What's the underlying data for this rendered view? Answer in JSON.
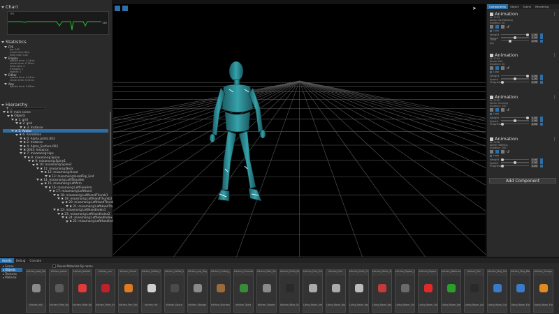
{
  "chart_panel": {
    "title": "Chart",
    "fps_label": "FPS",
    "fps_value": "165"
  },
  "statistics": {
    "title": "Statistics",
    "sections": [
      {
        "name": "FPS",
        "lines": [
          "fps: 165",
          "frame time: 6ms",
          "fixed rate: 0.02"
        ]
      },
      {
        "name": "Engine",
        "lines": [
          "update time: 0.14ms",
          "render time: 0.76ms",
          "draw calls: 4",
          "triangles: 1",
          "objects: 1"
        ]
      },
      {
        "name": "Editor",
        "lines": [
          "update time: 0.04ms",
          "render time: 0.01ms"
        ]
      },
      {
        "name": "App",
        "lines": [
          "update time: 0.08ms"
        ]
      }
    ]
  },
  "hierarchy": {
    "title": "Hierarchy",
    "items": [
      {
        "label": "0: main scene",
        "depth": 0,
        "selected": false
      },
      {
        "label": "Objects",
        "depth": 1,
        "selected": false
      },
      {
        "label": "1: grid",
        "depth": 2,
        "selected": false
      },
      {
        "label": "2: grid",
        "depth": 3,
        "selected": false
      },
      {
        "label": "3: Instance",
        "depth": 4,
        "selected": false
      },
      {
        "label": "5: Avatar",
        "depth": 2,
        "selected": true
      },
      {
        "label": "6: Animation",
        "depth": 3,
        "selected": false
      },
      {
        "label": "0: Alpha_Joints.003",
        "depth": 4,
        "selected": false
      },
      {
        "label": "2: Instance",
        "depth": 4,
        "selected": false
      },
      {
        "label": "4: Alpha_Surface.003",
        "depth": 4,
        "selected": false
      },
      {
        "label": "0003: Instance",
        "depth": 4,
        "selected": false
      },
      {
        "label": "7: mixamorig:Hips",
        "depth": 4,
        "selected": false
      },
      {
        "label": "8: mixamorig:Spine",
        "depth": 5,
        "selected": false
      },
      {
        "label": "9: mixamorig:Spine1",
        "depth": 6,
        "selected": false
      },
      {
        "label": "10: mixamorig:Spine2",
        "depth": 7,
        "selected": false
      },
      {
        "label": "11: mixamorig:Neck",
        "depth": 8,
        "selected": false
      },
      {
        "label": "12: mixamorig:Head",
        "depth": 9,
        "selected": false
      },
      {
        "label": "13: mixamorig:HeadTop_End",
        "depth": 10,
        "selected": false
      },
      {
        "label": "14: mixamorig:LeftShoulder",
        "depth": 8,
        "selected": false
      },
      {
        "label": "15: mixamorig:LeftArm",
        "depth": 9,
        "selected": false
      },
      {
        "label": "16: mixamorig:LeftForeArm",
        "depth": 10,
        "selected": false
      },
      {
        "label": "17: mixamorig:LeftHand",
        "depth": 11,
        "selected": false
      },
      {
        "label": "18: mixamorig:LeftHandThumb1",
        "depth": 12,
        "selected": false
      },
      {
        "label": "19: mixamorig:LeftHandThumb2",
        "depth": 13,
        "selected": false
      },
      {
        "label": "20: mixamorig:LeftHandThumb3",
        "depth": 14,
        "selected": false
      },
      {
        "label": "21: mixamorig:LeftHandThumb4",
        "depth": 15,
        "selected": false
      },
      {
        "label": "22: mixamorig:LeftHandIndex1",
        "depth": 12,
        "selected": false
      },
      {
        "label": "23: mixamorig:LeftHandIndex2",
        "depth": 13,
        "selected": false
      },
      {
        "label": "24: mixamorig:LeftHandIndex3",
        "depth": 14,
        "selected": false
      },
      {
        "label": "25: mixamorig:LeftHandIndex4",
        "depth": 15,
        "selected": false
      }
    ]
  },
  "inspector": {
    "tabs": [
      "Components",
      "Object",
      "Scene",
      "Rendering"
    ],
    "components": [
      {
        "title": "Animation",
        "id": "Id: 1743",
        "lines": [
          "Name: Idle/Walking",
          "Duration: 20"
        ],
        "loop_label": "Loop",
        "sliders": [
          {
            "label": "Weight",
            "value": "1.00",
            "pos": 1.0
          },
          {
            "label": "Speed",
            "value": "1.00",
            "pos": 0.5
          },
          {
            "label": "Time fps",
            "value": "0.90",
            "pos": 0.3
          }
        ]
      },
      {
        "title": "Animation",
        "id": "Id: 1744",
        "lines": [
          "Name: Idle",
          "Duration: 20"
        ],
        "loop_label": "Loop",
        "sliders": [
          {
            "label": "Weight",
            "value": "1.00",
            "pos": 1.0
          },
          {
            "label": "Speed",
            "value": "1.00",
            "pos": 0.5
          },
          {
            "label": "Progress",
            "value": "0.00",
            "pos": 0.0
          }
        ]
      },
      {
        "title": "Animation",
        "id": "Id: 1745",
        "lines": [
          "Name: Running",
          "Duration: 150"
        ],
        "loop_label": "Loop",
        "sliders": [
          {
            "label": "Weight",
            "value": "1.00",
            "pos": 1.0
          },
          {
            "label": "Speed",
            "value": "1.00",
            "pos": 0.5
          },
          {
            "label": "Progress",
            "value": "0.00",
            "pos": 0.0
          }
        ]
      },
      {
        "title": "Animation",
        "id": "Id: 1746",
        "lines": [
          "Name: Walking",
          "Duration: 100"
        ],
        "loop_label": "Loop",
        "sliders": [
          {
            "label": "Weight",
            "value": "0.00",
            "pos": 0.0
          },
          {
            "label": "Speed",
            "value": "1.00",
            "pos": 0.5
          },
          {
            "label": "Progress",
            "value": "0.00",
            "pos": 0.0
          }
        ]
      }
    ],
    "add_component": "Add Component"
  },
  "bottom": {
    "tabs": [
      "Assets",
      "Debug",
      "Console"
    ],
    "folders": [
      "Scene",
      "Objects",
      "Textures",
      "Material"
    ],
    "checkbox_label": "Reuse Materials By name",
    "assets": [
      {
        "top": "kitchen_bowl_NoMt",
        "bottom": "kitchen_Mix",
        "color": "#8a8a8a"
      },
      {
        "top": "kitchen_bottle",
        "bottom": "kitchen_Plate_Bowl_Mat",
        "color": "#5a5a5a"
      },
      {
        "top": "kitchen_bottle2",
        "bottom": "kitchen_Plate_Bowl_Knife",
        "color": "#e03a3a"
      },
      {
        "top": "kitchen_can",
        "bottom": "kitchen_Plate_Tray",
        "color": "#c0202a"
      },
      {
        "top": "kitchen_Carrot",
        "bottom": "kitchen_Pan_Flat",
        "color": "#e07a20"
      },
      {
        "top": "kitchen_Coffee_Cup",
        "bottom": "kitchen_Pot",
        "color": "#cfcfcf"
      },
      {
        "top": "kitchen_Coffee_Machine",
        "bottom": "kitchen_Sauce",
        "color": "#4a4a4a"
      },
      {
        "top": "kitchen_cup_Mug",
        "bottom": "kitchen_Storage",
        "color": "#8a8a8a"
      },
      {
        "top": "kitchen_Cutting_Board",
        "bottom": "kitchen_Sharpener_Knife",
        "color": "#9a6a3a"
      },
      {
        "top": "kitchen_Cucumber",
        "bottom": "kitchen_Toast",
        "color": "#3a8a3a"
      },
      {
        "top": "kitchen_Dish_Scrub",
        "bottom": "kitchen_Toaster",
        "color": "#8a8a8a"
      },
      {
        "top": "kitchen_Drink_Bottle",
        "bottom": "kitchen_Wine_Glass",
        "color": "#2a2a2a"
      },
      {
        "top": "kitchen_Fork_Knife",
        "bottom": "Living_Room_Armchair",
        "color": "#aaaaaa"
      },
      {
        "top": "kitchen_Fork",
        "bottom": "Living_Room_Book",
        "color": "#aaaaaa"
      },
      {
        "top": "kitchen_Knife_Cut",
        "bottom": "Living_Room_Bookshelf",
        "color": "#bbbbbb"
      },
      {
        "top": "kitchen_Melon_Slice",
        "bottom": "Living_Room_Books",
        "color": "#c23a3a"
      },
      {
        "top": "kitchen_Pepper_Mill",
        "bottom": "Living_Room_Chair",
        "color": "#6a6a6a"
      },
      {
        "top": "kitchen_Pepper",
        "bottom": "Living_Room_Coffee",
        "color": "#e02a2a"
      },
      {
        "top": "kitchen_Watermelon",
        "bottom": "Living_Room_Decor",
        "color": "#2aa02a"
      },
      {
        "top": "kitchen_Pan",
        "bottom": "Living_Room_Lamp",
        "color": "#2a2a2a"
      },
      {
        "top": "kitchen_Mug_Coffee",
        "bottom": "Living_Room_Coffee_Table",
        "color": "#3a7ac8"
      },
      {
        "top": "kitchen_Mug_Marble",
        "bottom": "Living_Room_Flower_Vase",
        "color": "#3a7ac8"
      },
      {
        "top": "kitchen_Orange",
        "bottom": "Living_Room_Flower_Vase2",
        "color": "#e08a20"
      }
    ]
  },
  "colors": {
    "accent": "#2b6ea8",
    "model": "#2d8a92",
    "grid": "#6a6a6a"
  }
}
